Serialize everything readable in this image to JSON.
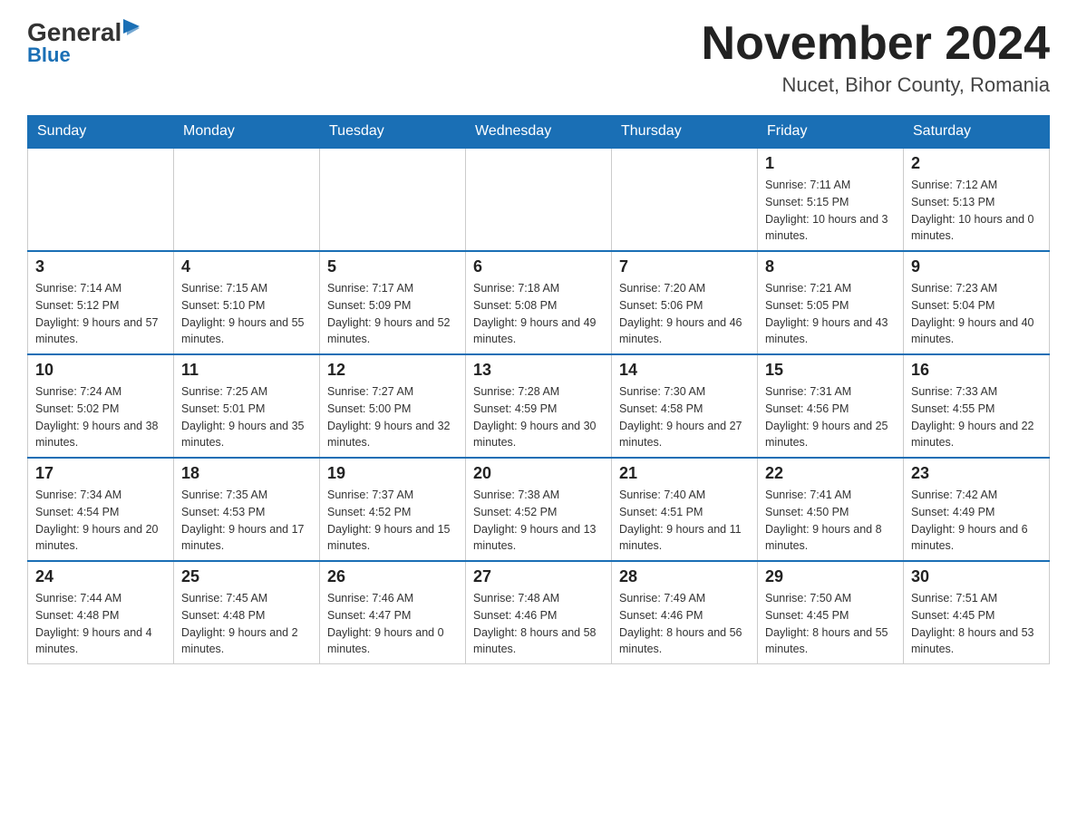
{
  "header": {
    "logo_general": "General",
    "logo_blue": "Blue",
    "month_title": "November 2024",
    "location": "Nucet, Bihor County, Romania"
  },
  "weekdays": [
    "Sunday",
    "Monday",
    "Tuesday",
    "Wednesday",
    "Thursday",
    "Friday",
    "Saturday"
  ],
  "weeks": [
    [
      {
        "day": "",
        "info": ""
      },
      {
        "day": "",
        "info": ""
      },
      {
        "day": "",
        "info": ""
      },
      {
        "day": "",
        "info": ""
      },
      {
        "day": "",
        "info": ""
      },
      {
        "day": "1",
        "info": "Sunrise: 7:11 AM\nSunset: 5:15 PM\nDaylight: 10 hours and 3 minutes."
      },
      {
        "day": "2",
        "info": "Sunrise: 7:12 AM\nSunset: 5:13 PM\nDaylight: 10 hours and 0 minutes."
      }
    ],
    [
      {
        "day": "3",
        "info": "Sunrise: 7:14 AM\nSunset: 5:12 PM\nDaylight: 9 hours and 57 minutes."
      },
      {
        "day": "4",
        "info": "Sunrise: 7:15 AM\nSunset: 5:10 PM\nDaylight: 9 hours and 55 minutes."
      },
      {
        "day": "5",
        "info": "Sunrise: 7:17 AM\nSunset: 5:09 PM\nDaylight: 9 hours and 52 minutes."
      },
      {
        "day": "6",
        "info": "Sunrise: 7:18 AM\nSunset: 5:08 PM\nDaylight: 9 hours and 49 minutes."
      },
      {
        "day": "7",
        "info": "Sunrise: 7:20 AM\nSunset: 5:06 PM\nDaylight: 9 hours and 46 minutes."
      },
      {
        "day": "8",
        "info": "Sunrise: 7:21 AM\nSunset: 5:05 PM\nDaylight: 9 hours and 43 minutes."
      },
      {
        "day": "9",
        "info": "Sunrise: 7:23 AM\nSunset: 5:04 PM\nDaylight: 9 hours and 40 minutes."
      }
    ],
    [
      {
        "day": "10",
        "info": "Sunrise: 7:24 AM\nSunset: 5:02 PM\nDaylight: 9 hours and 38 minutes."
      },
      {
        "day": "11",
        "info": "Sunrise: 7:25 AM\nSunset: 5:01 PM\nDaylight: 9 hours and 35 minutes."
      },
      {
        "day": "12",
        "info": "Sunrise: 7:27 AM\nSunset: 5:00 PM\nDaylight: 9 hours and 32 minutes."
      },
      {
        "day": "13",
        "info": "Sunrise: 7:28 AM\nSunset: 4:59 PM\nDaylight: 9 hours and 30 minutes."
      },
      {
        "day": "14",
        "info": "Sunrise: 7:30 AM\nSunset: 4:58 PM\nDaylight: 9 hours and 27 minutes."
      },
      {
        "day": "15",
        "info": "Sunrise: 7:31 AM\nSunset: 4:56 PM\nDaylight: 9 hours and 25 minutes."
      },
      {
        "day": "16",
        "info": "Sunrise: 7:33 AM\nSunset: 4:55 PM\nDaylight: 9 hours and 22 minutes."
      }
    ],
    [
      {
        "day": "17",
        "info": "Sunrise: 7:34 AM\nSunset: 4:54 PM\nDaylight: 9 hours and 20 minutes."
      },
      {
        "day": "18",
        "info": "Sunrise: 7:35 AM\nSunset: 4:53 PM\nDaylight: 9 hours and 17 minutes."
      },
      {
        "day": "19",
        "info": "Sunrise: 7:37 AM\nSunset: 4:52 PM\nDaylight: 9 hours and 15 minutes."
      },
      {
        "day": "20",
        "info": "Sunrise: 7:38 AM\nSunset: 4:52 PM\nDaylight: 9 hours and 13 minutes."
      },
      {
        "day": "21",
        "info": "Sunrise: 7:40 AM\nSunset: 4:51 PM\nDaylight: 9 hours and 11 minutes."
      },
      {
        "day": "22",
        "info": "Sunrise: 7:41 AM\nSunset: 4:50 PM\nDaylight: 9 hours and 8 minutes."
      },
      {
        "day": "23",
        "info": "Sunrise: 7:42 AM\nSunset: 4:49 PM\nDaylight: 9 hours and 6 minutes."
      }
    ],
    [
      {
        "day": "24",
        "info": "Sunrise: 7:44 AM\nSunset: 4:48 PM\nDaylight: 9 hours and 4 minutes."
      },
      {
        "day": "25",
        "info": "Sunrise: 7:45 AM\nSunset: 4:48 PM\nDaylight: 9 hours and 2 minutes."
      },
      {
        "day": "26",
        "info": "Sunrise: 7:46 AM\nSunset: 4:47 PM\nDaylight: 9 hours and 0 minutes."
      },
      {
        "day": "27",
        "info": "Sunrise: 7:48 AM\nSunset: 4:46 PM\nDaylight: 8 hours and 58 minutes."
      },
      {
        "day": "28",
        "info": "Sunrise: 7:49 AM\nSunset: 4:46 PM\nDaylight: 8 hours and 56 minutes."
      },
      {
        "day": "29",
        "info": "Sunrise: 7:50 AM\nSunset: 4:45 PM\nDaylight: 8 hours and 55 minutes."
      },
      {
        "day": "30",
        "info": "Sunrise: 7:51 AM\nSunset: 4:45 PM\nDaylight: 8 hours and 53 minutes."
      }
    ]
  ]
}
